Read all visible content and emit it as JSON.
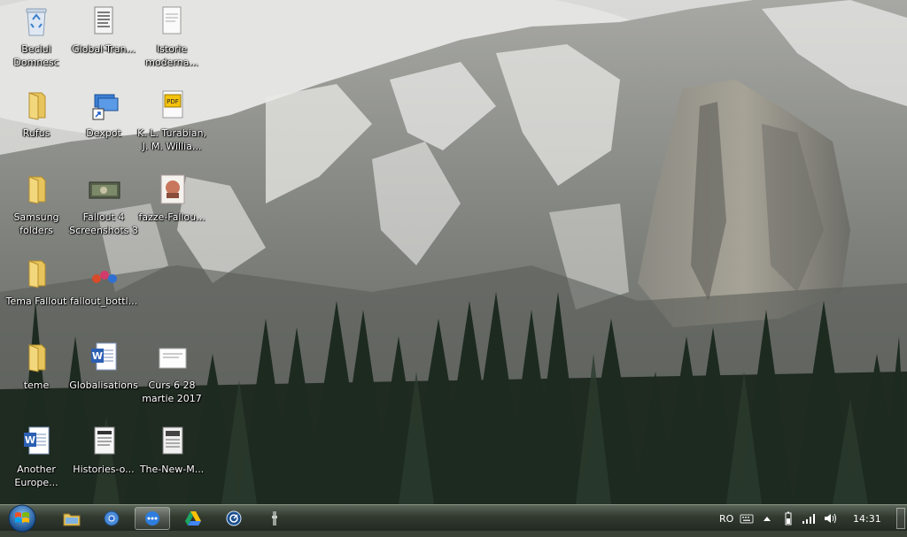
{
  "desktop": {
    "icons": [
      {
        "label": "Beciul Domnesc",
        "icon": "recycle-bin-icon"
      },
      {
        "label": "Global-Tran...",
        "icon": "document-icon"
      },
      {
        "label": "Istorie moderna...",
        "icon": "document-icon"
      },
      {
        "label": "Rufus",
        "icon": "folder-icon"
      },
      {
        "label": "Dexpot",
        "icon": "dexpot-shortcut-icon"
      },
      {
        "label": "K. L. Turabian, J. M. Willia...",
        "icon": "pdf-icon"
      },
      {
        "label": "Samsung folders",
        "icon": "folder-icon"
      },
      {
        "label": "Fallout 4 Screenshots 3",
        "icon": "screenshot-folder-icon"
      },
      {
        "label": "fazze-Fallou...",
        "icon": "image-icon"
      },
      {
        "label": "Tema Fallout",
        "icon": "folder-icon"
      },
      {
        "label": "fallout_bottl...",
        "icon": "image-icon"
      },
      {
        "label": "teme",
        "icon": "folder-icon"
      },
      {
        "label": "Globalisations",
        "icon": "word-document-icon"
      },
      {
        "label": "Curs 6 28 martie 2017",
        "icon": "document-icon"
      },
      {
        "label": "Another Europe...",
        "icon": "word-document-icon"
      },
      {
        "label": "Histories-o...",
        "icon": "document-icon"
      },
      {
        "label": "The-New-M...",
        "icon": "document-icon"
      }
    ]
  },
  "taskbar": {
    "start": "windows-start-orb-icon",
    "pinned": [
      {
        "icon": "file-explorer-icon"
      },
      {
        "icon": "chrome-icon"
      },
      {
        "icon": "dexpot-icon",
        "active": true
      },
      {
        "icon": "google-drive-icon"
      },
      {
        "icon": "steam-icon"
      },
      {
        "icon": "fallout-game-icon"
      }
    ],
    "tray": {
      "language": "RO",
      "clock": "14:31"
    }
  },
  "colors": {
    "taskbar_bg": "#323a30",
    "folder": "#e7c45f",
    "word_blue": "#2b5fb3",
    "pdf_yellow": "#f4c20d"
  }
}
